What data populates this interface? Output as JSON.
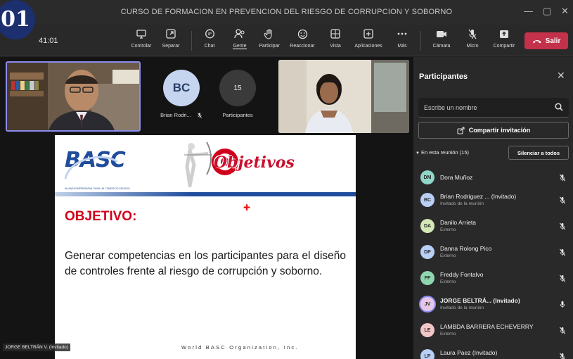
{
  "badge": "01",
  "window": {
    "title": "CURSO DE FORMACION EN PREVENCION DEL RIESGO DE CORRUPCION Y SOBORNO",
    "controls": [
      "—",
      "▢",
      "✕"
    ]
  },
  "toolbar": {
    "timer": "41:01",
    "buttons": [
      {
        "label": "Controlar",
        "icon": "control-icon"
      },
      {
        "label": "Separar",
        "icon": "popout-icon"
      },
      {
        "label": "Chat",
        "icon": "chat-icon"
      },
      {
        "label": "Gente",
        "icon": "people-icon"
      },
      {
        "label": "Participar",
        "icon": "raise-hand-icon"
      },
      {
        "label": "Reaccionar",
        "icon": "react-icon"
      },
      {
        "label": "Vista",
        "icon": "view-icon"
      },
      {
        "label": "Aplicaciones",
        "icon": "apps-icon"
      },
      {
        "label": "Más",
        "icon": "more-icon"
      },
      {
        "label": "Cámara",
        "icon": "camera-icon"
      },
      {
        "label": "Micro",
        "icon": "mic-off-icon"
      },
      {
        "label": "Compartir",
        "icon": "share-icon"
      }
    ],
    "leave_label": "Salir",
    "accent": "#c4314b"
  },
  "stage": {
    "avatar_tile": {
      "initials": "BC",
      "name": "Brian Rodri..."
    },
    "count_tile": {
      "count": "15",
      "label": "Participantes"
    },
    "name_tag": "JORGE BELTRÁN V. (Invitado)"
  },
  "slide": {
    "logo": "BASC",
    "logo_sub": "ALIANZA EMPRESARIAL PARA UN COMERCIO SEGURO",
    "banner": "Objetivos",
    "heading": "OBJETIVO:",
    "body": "Generar competencias en los participantes para el diseño de controles frente al riesgo de corrupción y soborno.",
    "footer": "World BASC Organization, Inc."
  },
  "panel": {
    "title": "Participantes",
    "search_placeholder": "Escribe un nombre",
    "share_label": "Compartir invitación",
    "section_label": "En esta reunión (15)",
    "mute_all_label": "Silenciar a todos",
    "participants": [
      {
        "initials": "DM",
        "name": "Dora Muñoz",
        "role": "",
        "color": "#8fd6c9",
        "mic": "off"
      },
      {
        "initials": "BC",
        "name": "Brian Rodriguez ... (Invitado)",
        "role": "Invitado de la reunión",
        "color": "#b9cff5",
        "mic": "off"
      },
      {
        "initials": "DA",
        "name": "Danilo Arrieta",
        "role": "Externo",
        "color": "#d3e8b6",
        "mic": "off"
      },
      {
        "initials": "DP",
        "name": "Danna Rolong Pico",
        "role": "Externo",
        "color": "#b9cff5",
        "mic": "off"
      },
      {
        "initials": "FF",
        "name": "Freddy Fontalvo",
        "role": "Externo",
        "color": "#8fd6b0",
        "mic": "off"
      },
      {
        "initials": "JV",
        "name": "JORGE BELTRÁ... (Invitado)",
        "role": "Invitado de la reunión",
        "color": "#e7c7e8",
        "mic": "on"
      },
      {
        "initials": "LE",
        "name": "LAMBDA BARRERA ECHEVERRY",
        "role": "Externo",
        "color": "#f2c6c6",
        "mic": "off"
      },
      {
        "initials": "LP",
        "name": "Laura Paez (Invitado)",
        "role": "",
        "color": "#b9cff5",
        "mic": "off"
      }
    ]
  }
}
